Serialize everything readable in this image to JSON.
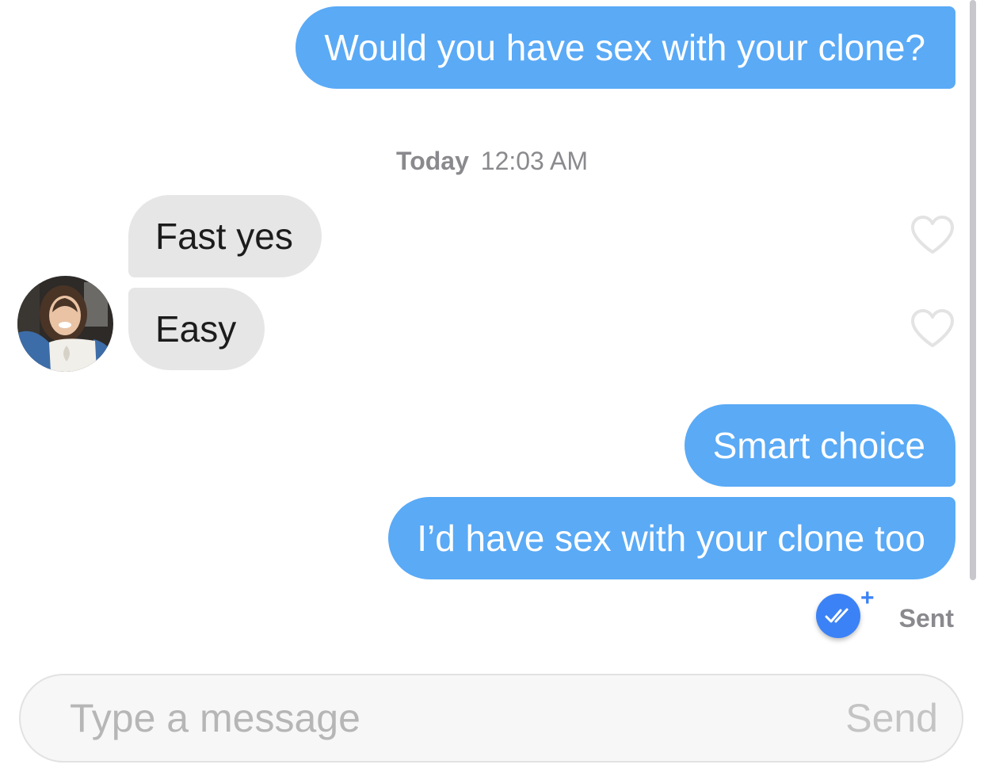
{
  "conversation": {
    "messages": [
      {
        "direction": "outgoing",
        "text": "Would you have sex with your clone?"
      },
      {
        "direction": "incoming",
        "text": "Fast yes"
      },
      {
        "direction": "incoming",
        "text": "Easy"
      },
      {
        "direction": "outgoing",
        "text": "Smart choice"
      },
      {
        "direction": "outgoing",
        "text": "I’d have sex with your clone too"
      }
    ],
    "timestamp": {
      "day": "Today",
      "time": "12:03 AM"
    },
    "read_receipt": {
      "icon": "double-check-icon",
      "badge": "+",
      "status": "Sent"
    }
  },
  "composer": {
    "placeholder": "Type a message",
    "value": "",
    "send_label": "Send"
  },
  "colors": {
    "outgoing_bubble": "#5aaaf6",
    "incoming_bubble": "#e6e6e6",
    "accent": "#3b82f6",
    "muted_text": "#8a8a8e"
  }
}
